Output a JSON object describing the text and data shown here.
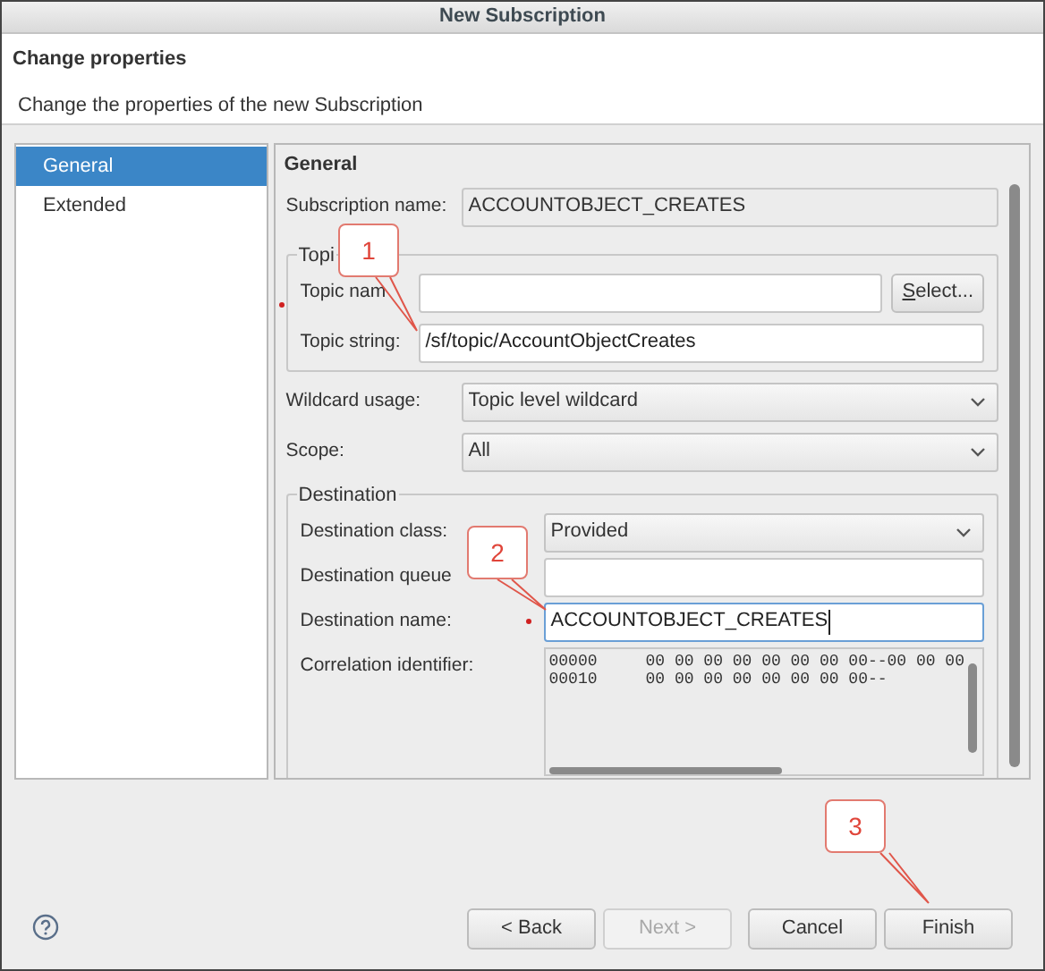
{
  "window": {
    "title": "New Subscription"
  },
  "header": {
    "title": "Change properties",
    "description": "Change the properties of the new Subscription"
  },
  "nav": [
    {
      "label": "General",
      "selected": true
    },
    {
      "label": "Extended",
      "selected": false
    }
  ],
  "section_title": "General",
  "fields": [
    {
      "kind": "readonly",
      "label": "Subscription name:",
      "value": "ACCOUNTOBJECT_CREATES"
    },
    {
      "kind": "group",
      "legend": "Topi",
      "required": true,
      "rows": [
        {
          "kind": "text",
          "label": "Topic nam",
          "value": "",
          "button": "Select..."
        },
        {
          "kind": "text",
          "label": "Topic string:",
          "value": "/sf/topic/AccountObjectCreates"
        }
      ]
    },
    {
      "kind": "dropdown",
      "label": "Wildcard usage:",
      "value": "Topic level wildcard"
    },
    {
      "kind": "dropdown",
      "label": "Scope:",
      "value": "All"
    },
    {
      "kind": "group",
      "legend": "Destination",
      "required": false,
      "rows": [
        {
          "kind": "dropdown",
          "label": "Destination class:",
          "value": "Provided"
        },
        {
          "kind": "text",
          "label": "Destination queue",
          "value": ""
        },
        {
          "kind": "text",
          "label": "Destination name:",
          "value": "ACCOUNTOBJECT_CREATES",
          "required": true,
          "focused": true
        },
        {
          "kind": "hex",
          "label": "Correlation identifier:",
          "lines": [
            "00000     00 00 00 00 00 00 00 00--00 00 00",
            "00010     00 00 00 00 00 00 00 00--"
          ]
        }
      ]
    }
  ],
  "buttons": [
    {
      "label": "< Back",
      "disabled": false
    },
    {
      "label": "Next >",
      "disabled": true
    },
    {
      "label": "Cancel",
      "disabled": false
    },
    {
      "label": "Finish",
      "disabled": false
    }
  ],
  "callouts": [
    {
      "number": "1"
    },
    {
      "number": "2"
    },
    {
      "number": "3"
    }
  ]
}
